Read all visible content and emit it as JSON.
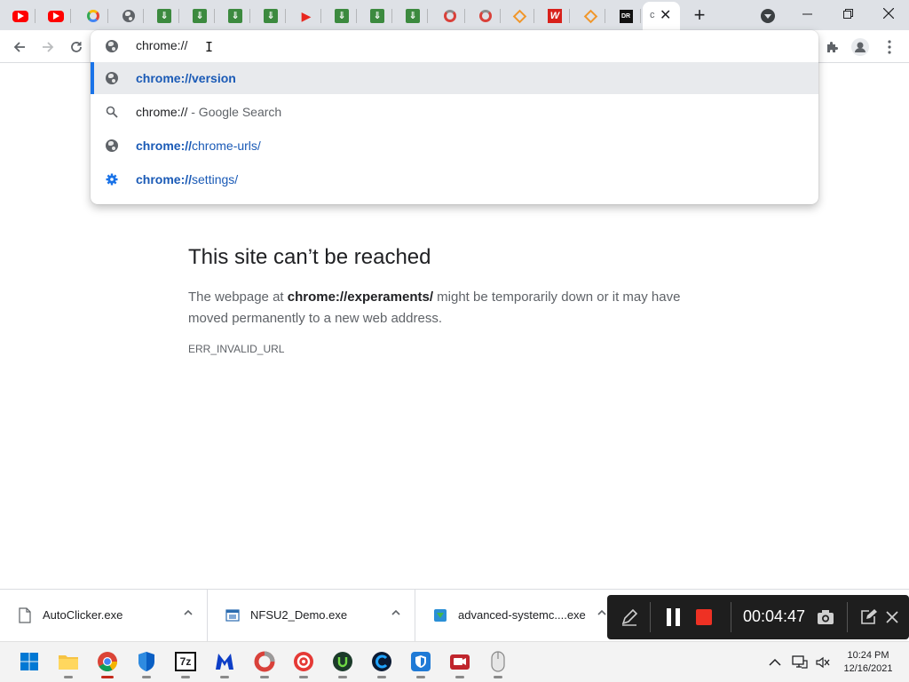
{
  "colors": {
    "accent": "#1a73e8",
    "url_blue": "#1a5ab6",
    "tab_strip": "#dee1e6",
    "record_red": "#ee3124"
  },
  "tabs": {
    "favicons": [
      "youtube-icon",
      "youtube-icon",
      "google-icon",
      "globe-icon",
      "green-download-icon",
      "green-download-icon",
      "green-download-icon",
      "green-download-icon",
      "red-play-icon",
      "green-download-icon",
      "green-download-icon",
      "green-download-icon",
      "ccleaner-icon",
      "ccleaner-icon",
      "orange-diamond-icon",
      "w-icon",
      "orange-diamond-icon",
      "dr-icon"
    ],
    "active_tab_text": "c",
    "new_tab_label": "+"
  },
  "omnibox": {
    "input_value": "chrome://",
    "suggestions": [
      {
        "icon": "globe-icon",
        "bold": "chrome://version",
        "rest": "",
        "suffix": ""
      },
      {
        "icon": "search-icon",
        "bold": "",
        "rest": "chrome://",
        "suffix": " - Google Search"
      },
      {
        "icon": "globe-icon",
        "bold": "chrome://",
        "rest": "chrome-urls/",
        "suffix": ""
      },
      {
        "icon": "gear-icon",
        "bold": "chrome://",
        "rest": "settings/",
        "suffix": ""
      }
    ]
  },
  "error": {
    "title": "This site can’t be reached",
    "body_prefix": "The webpage at ",
    "url": "chrome://experaments/",
    "body_suffix": " might be temporarily down or it may have moved permanently to a new web address.",
    "code": "ERR_INVALID_URL"
  },
  "downloads": [
    {
      "name": "AutoClicker.exe",
      "icon": "file-icon"
    },
    {
      "name": "NFSU2_Demo.exe",
      "icon": "window-app-icon"
    },
    {
      "name": "advanced-systemc....exe",
      "icon": "installer-icon"
    }
  ],
  "recorder": {
    "time": "00:04:47"
  },
  "taskbar": {
    "apps": [
      "start-icon",
      "file-explorer-icon",
      "chrome-icon",
      "defender-icon",
      "7zip-icon",
      "malwarebytes-icon",
      "ccleaner-icon",
      "tool-icon",
      "upwork-icon",
      "c-app-icon",
      "security-app-icon",
      "video-recorder-icon",
      "mouse-icon"
    ],
    "clock_time": "10:24 PM",
    "clock_date": "12/16/2021"
  }
}
